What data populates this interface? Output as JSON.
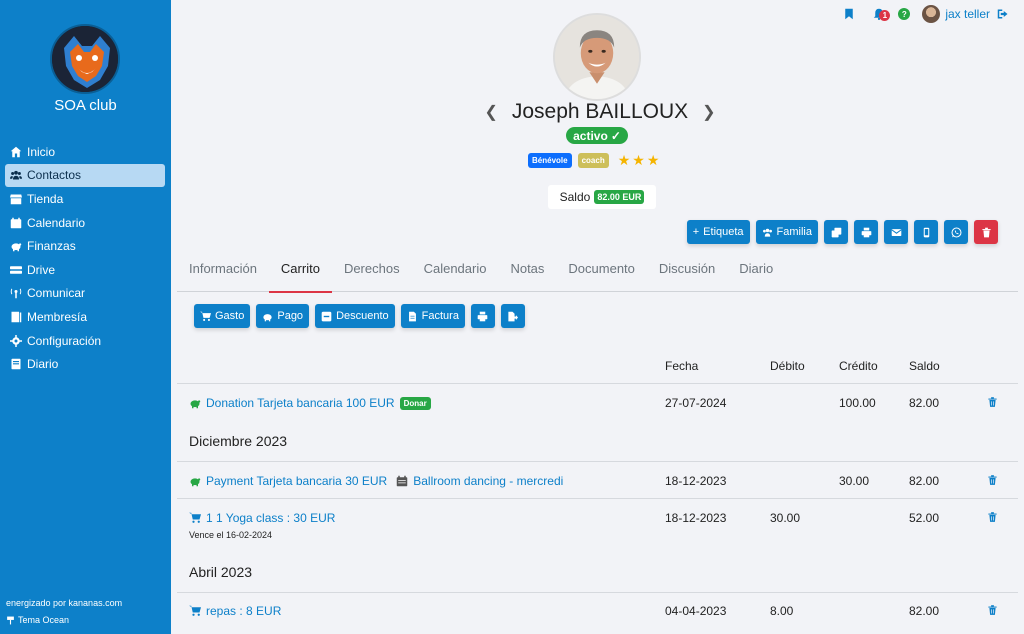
{
  "sidebar": {
    "club_name": "SOA club",
    "items": [
      {
        "label": "Inicio",
        "icon": "home-icon"
      },
      {
        "label": "Contactos",
        "icon": "users-icon",
        "active": true
      },
      {
        "label": "Tienda",
        "icon": "store-icon"
      },
      {
        "label": "Calendario",
        "icon": "calendar-icon"
      },
      {
        "label": "Finanzas",
        "icon": "piggy-bank-icon"
      },
      {
        "label": "Drive",
        "icon": "drive-icon"
      },
      {
        "label": "Comunicar",
        "icon": "broadcast-icon"
      },
      {
        "label": "Membresía",
        "icon": "book-icon"
      },
      {
        "label": "Configuración",
        "icon": "gear-icon"
      },
      {
        "label": "Diario",
        "icon": "journal-icon"
      }
    ],
    "powered_by": "energizado por kananas.com",
    "theme": "Tema Ocean"
  },
  "topbar": {
    "notification_count": "1",
    "help": "?",
    "username": "jax teller"
  },
  "profile": {
    "name": "Joseph BAILLOUX",
    "status": "activo",
    "tags": [
      "Bénévole",
      "coach"
    ],
    "stars": 3,
    "saldo_label": "Saldo",
    "saldo_value": "82.00 EUR"
  },
  "actions": {
    "etiqueta": "Etiqueta",
    "familia": "Familia"
  },
  "tabs": [
    "Información",
    "Carrito",
    "Derechos",
    "Calendario",
    "Notas",
    "Documento",
    "Discusión",
    "Diario"
  ],
  "active_tab": "Carrito",
  "cart_buttons": {
    "gasto": "Gasto",
    "pago": "Pago",
    "descuento": "Descuento",
    "factura": "Factura"
  },
  "table": {
    "headers": {
      "fecha": "Fecha",
      "debito": "Débito",
      "credito": "Crédito",
      "saldo": "Saldo"
    },
    "row1": {
      "desc": "Donation Tarjeta bancaria 100 EUR",
      "badge": "Donar",
      "fecha": "27-07-2024",
      "debito": "",
      "credito": "100.00",
      "saldo": "82.00"
    },
    "group1": "Diciembre 2023",
    "row2": {
      "desc": "Payment Tarjeta bancaria 30 EUR",
      "event": "Ballroom dancing - mercredi",
      "fecha": "18-12-2023",
      "debito": "",
      "credito": "30.00",
      "saldo": "82.00"
    },
    "row3": {
      "desc": "1 1 Yoga class : 30 EUR",
      "sub": "Vence el 16-02-2024",
      "fecha": "18-12-2023",
      "debito": "30.00",
      "credito": "",
      "saldo": "52.00"
    },
    "group2": "Abril 2023",
    "row4": {
      "desc": "repas : 8 EUR",
      "fecha": "04-04-2023",
      "debito": "8.00",
      "credito": "",
      "saldo": "82.00"
    }
  }
}
